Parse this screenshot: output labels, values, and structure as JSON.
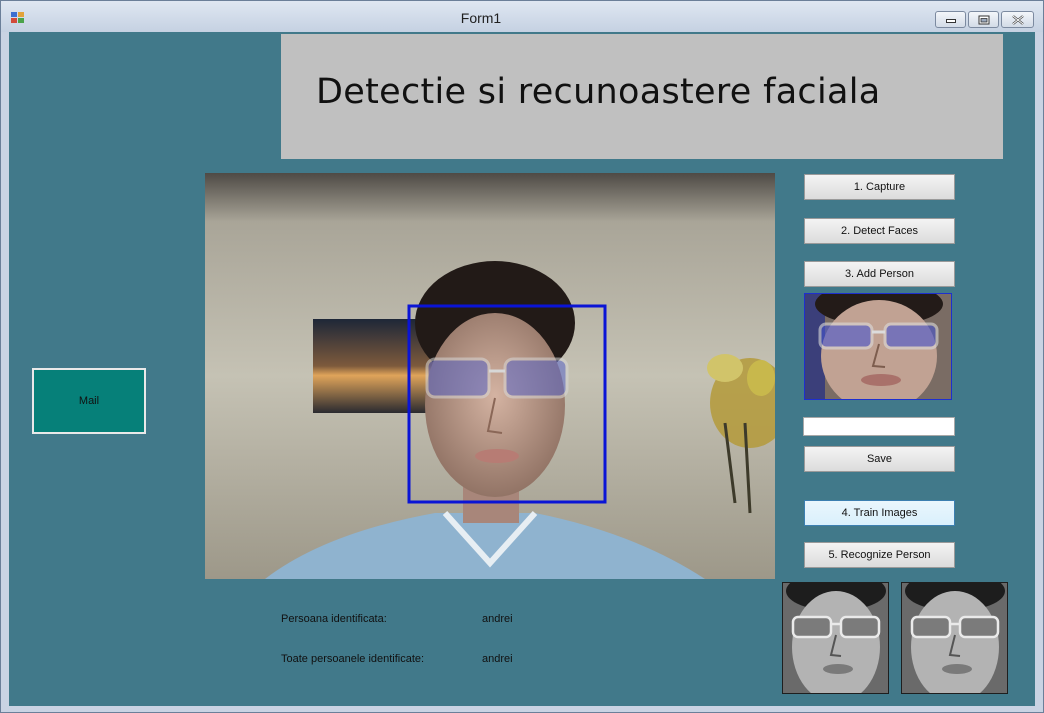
{
  "window": {
    "title": "Form1",
    "controls": [
      "minimize-icon",
      "restore-icon",
      "close-icon"
    ]
  },
  "header": {
    "title": "Detectie si recunoastere faciala"
  },
  "mail_button": {
    "label": "Mail"
  },
  "side_panel": {
    "capture_label": "1. Capture",
    "detect_label": "2. Detect Faces",
    "add_person_label": "3. Add Person",
    "name_input_value": "",
    "save_label": "Save",
    "train_label": "4. Train Images",
    "recognize_label": "5. Recognize Person"
  },
  "results": {
    "identified_label": "Persoana identificata:",
    "identified_value": "andrei",
    "all_identified_label": "Toate persoanele identificate:",
    "all_identified_value": "andrei"
  },
  "colors": {
    "client_bg": "#41798a",
    "header_bg": "#c0c0c0",
    "mail_button_bg": "#068079",
    "face_box": "#0a14d6"
  }
}
